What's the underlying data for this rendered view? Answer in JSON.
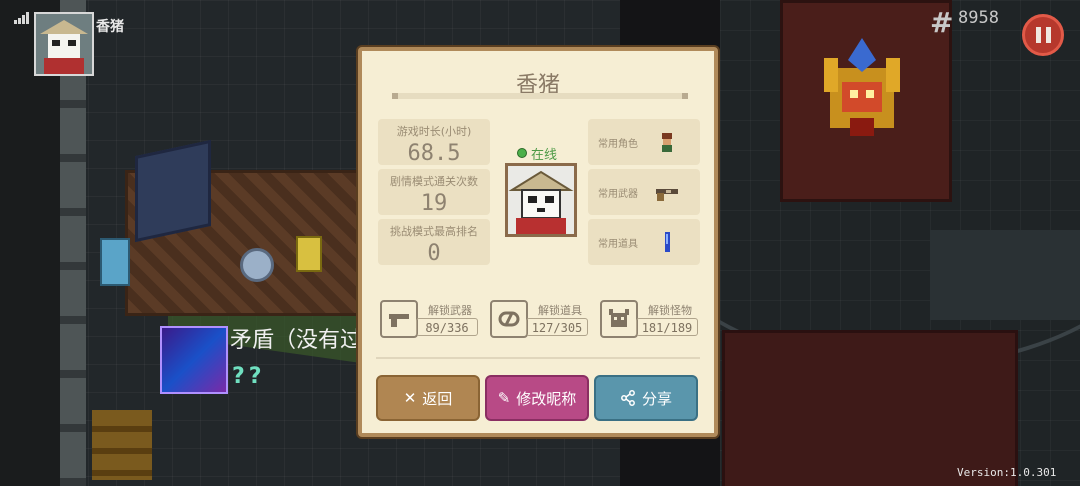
{
  "hud": {
    "player_name": "香猪",
    "coins": "8958",
    "version": "Version:1.0.301",
    "item_label": "矛盾（没有过"
  },
  "profile": {
    "title": "香猪",
    "status": "在线",
    "stats": [
      {
        "label": "游戏时长(小时)",
        "value": "68.5"
      },
      {
        "label": "剧情模式通关次数",
        "value": "19"
      },
      {
        "label": "挑战模式最高排名",
        "value": "0"
      }
    ],
    "favorites": [
      {
        "label": "常用角色",
        "icon": "character-icon"
      },
      {
        "label": "常用武器",
        "icon": "revolver-icon"
      },
      {
        "label": "常用道具",
        "icon": "item-vial-icon"
      }
    ],
    "unlocks": [
      {
        "label": "解锁武器",
        "count": "89/336",
        "icon": "pistol-icon"
      },
      {
        "label": "解锁道具",
        "count": "127/305",
        "icon": "pill-icon"
      },
      {
        "label": "解锁怪物",
        "count": "181/189",
        "icon": "monster-icon"
      }
    ]
  },
  "buttons": {
    "back": "返回",
    "edit_nickname": "修改昵称",
    "share": "分享"
  },
  "colors": {
    "dialog_bg": "#f6eed4",
    "back_button": "#b08652",
    "edit_button": "#b84a86",
    "share_button": "#5a96ac",
    "online": "#4c9a46",
    "pause_button": "#b6382c"
  }
}
